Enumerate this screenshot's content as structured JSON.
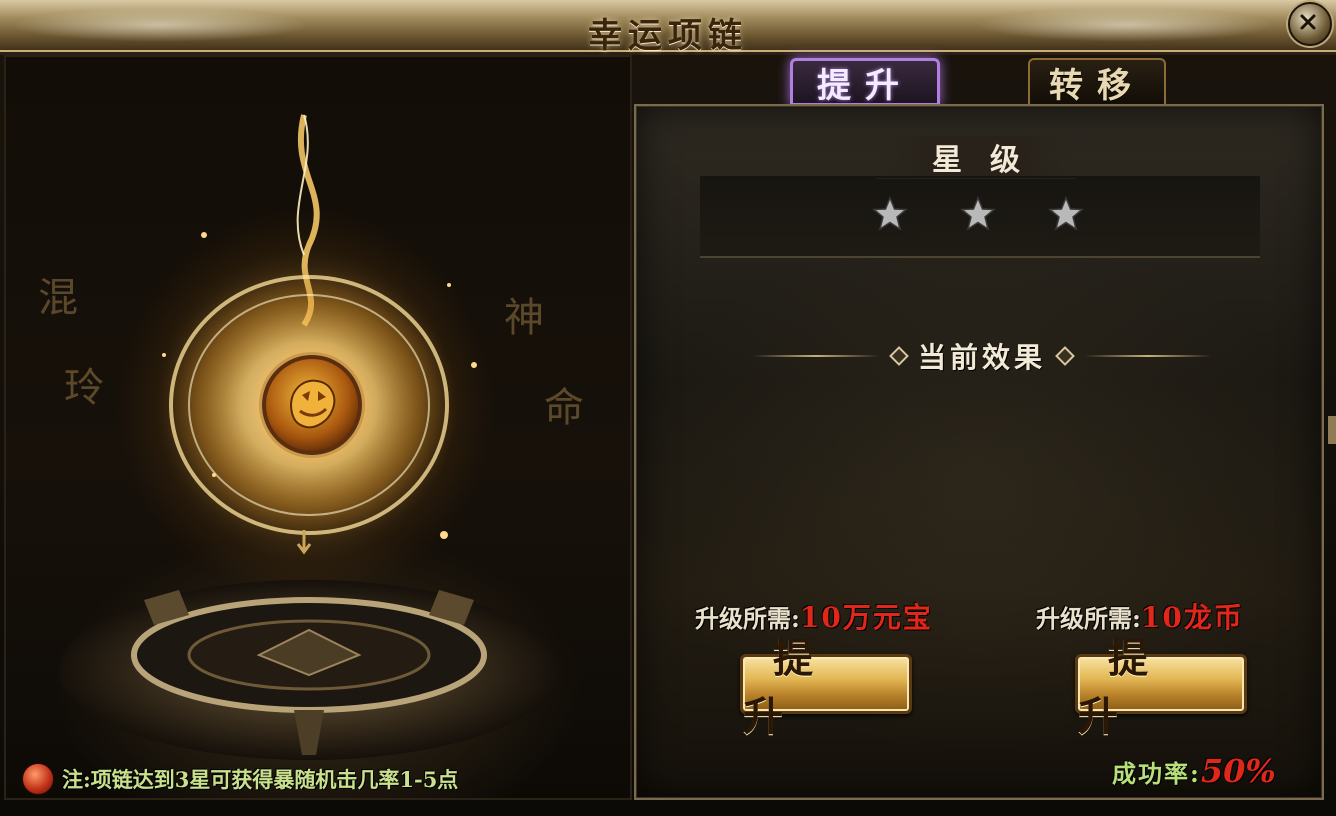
{
  "window": {
    "title": "幸运项链"
  },
  "tabs": [
    {
      "label": "提升",
      "active": true
    },
    {
      "label": "转移",
      "active": false
    }
  ],
  "scene": {
    "glyphs": [
      "混",
      "玲",
      "神",
      "命"
    ],
    "item_icon": "golden-beast-necklace-icon"
  },
  "note": {
    "text": "注:项链达到3星可获得暴随机击几率1-5点"
  },
  "panel": {
    "star_label": "星级",
    "stars_filled": 0,
    "stars_total": 3,
    "effect_title": "当前效果",
    "costs": [
      {
        "label": "升级所需:",
        "value": "10万元宝"
      },
      {
        "label": "升级所需:",
        "value": "10龙币"
      }
    ],
    "buttons": [
      {
        "label": "提升"
      },
      {
        "label": "提升"
      }
    ],
    "success_rate": {
      "label": "成功率:",
      "value": "50%"
    }
  },
  "colors": {
    "accent_purple": "#b07fe0",
    "cost_red": "#e0271a",
    "note_green": "#c9e08d",
    "gold": "#e3b855"
  }
}
